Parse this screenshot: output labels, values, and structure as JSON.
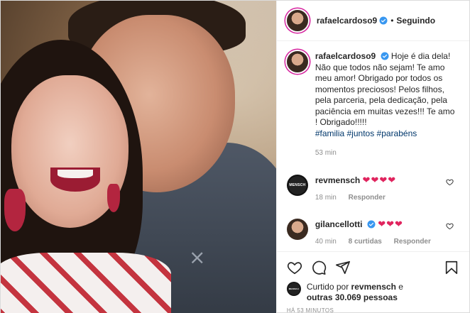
{
  "header": {
    "username": "rafaelcardoso9",
    "dot": "•",
    "follow_status": "Seguindo"
  },
  "caption": {
    "username": "rafaelcardoso9",
    "text": "Hoje é dia dela! Não que todos não sejam! Te amo meu amor! Obrigado por todos os momentos preciosos! Pelos filhos, pela parceria, pela dedicação, pela paciência em muitas vezes!!! Te amo ! Obrigado!!!!!",
    "tags": "#familia #juntos #parabéns",
    "time": "53 min"
  },
  "comments": [
    {
      "username": "revmensch",
      "avatar_text": "MENSCH",
      "text": "❤❤❤❤",
      "time": "18 min",
      "reply": "Responder",
      "likes": ""
    },
    {
      "username": "gilancellotti",
      "avatar_text": "",
      "text": "❤❤❤",
      "time": "40 min",
      "likes": "8 curtidas",
      "reply": "Responder"
    }
  ],
  "likes": {
    "prefix": "Curtido por",
    "user": "revmensch",
    "connector": "e",
    "others": "outras 30.069 pessoas",
    "avatar_text": "MENSCH"
  },
  "posted": "HÁ 53 MINUTOS",
  "colors": {
    "verified": "#3897f0",
    "heart": "#e0245e",
    "link": "#00376b",
    "muted": "#8e8e8e"
  },
  "icons": [
    "like-icon",
    "comment-icon",
    "share-icon",
    "save-icon",
    "verified-icon"
  ]
}
